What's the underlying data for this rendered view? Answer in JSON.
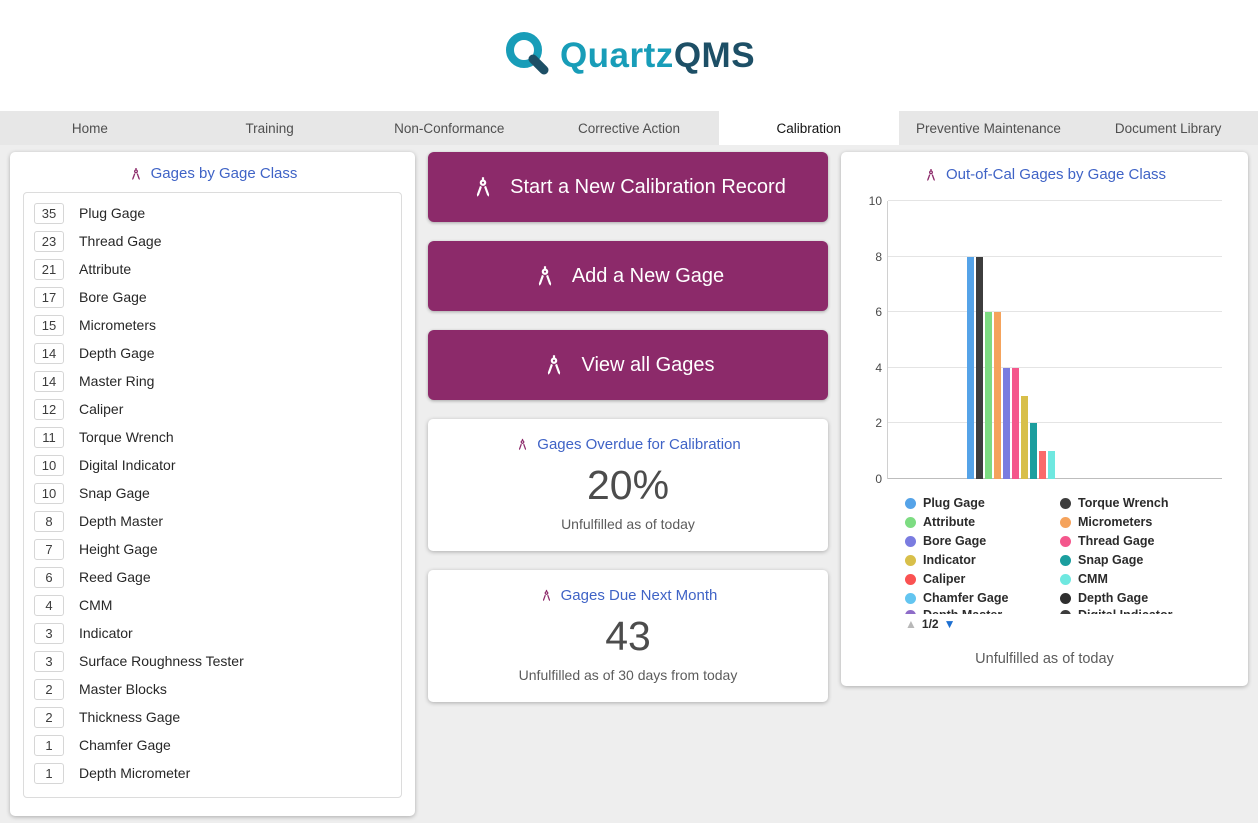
{
  "colors": {
    "accent_purple": "#8c2a6a",
    "title_blue": "#3f63c6",
    "brand_teal": "#189db8",
    "brand_navy": "#1d4f66"
  },
  "brand": {
    "name_primary": "Quartz",
    "name_secondary": "QMS"
  },
  "nav": {
    "active_tab": "Calibration",
    "tabs": [
      "Home",
      "Training",
      "Non-Conformance",
      "Corrective Action",
      "Calibration",
      "Preventive Maintenance",
      "Document Library"
    ]
  },
  "left_panel": {
    "title": "Gages by Gage Class",
    "items": [
      {
        "count": "35",
        "label": "Plug Gage"
      },
      {
        "count": "23",
        "label": "Thread Gage"
      },
      {
        "count": "21",
        "label": "Attribute"
      },
      {
        "count": "17",
        "label": "Bore Gage"
      },
      {
        "count": "15",
        "label": "Micrometers"
      },
      {
        "count": "14",
        "label": "Depth Gage"
      },
      {
        "count": "14",
        "label": "Master Ring"
      },
      {
        "count": "12",
        "label": "Caliper"
      },
      {
        "count": "11",
        "label": "Torque Wrench"
      },
      {
        "count": "10",
        "label": "Digital Indicator"
      },
      {
        "count": "10",
        "label": "Snap Gage"
      },
      {
        "count": "8",
        "label": "Depth Master"
      },
      {
        "count": "7",
        "label": "Height Gage"
      },
      {
        "count": "6",
        "label": "Reed Gage"
      },
      {
        "count": "4",
        "label": "CMM"
      },
      {
        "count": "3",
        "label": "Indicator"
      },
      {
        "count": "3",
        "label": "Surface Roughness Tester"
      },
      {
        "count": "2",
        "label": "Master Blocks"
      },
      {
        "count": "2",
        "label": "Thickness Gage"
      },
      {
        "count": "1",
        "label": "Chamfer Gage"
      },
      {
        "count": "1",
        "label": "Depth Micrometer"
      }
    ]
  },
  "actions": {
    "start_calibration": "Start a New Calibration Record",
    "add_gage": "Add a New Gage",
    "view_gages": "View all Gages"
  },
  "overdue_card": {
    "title": "Gages Overdue for Calibration",
    "value": "20%",
    "subtitle": "Unfulfilled as of today"
  },
  "due_card": {
    "title": "Gages Due Next Month",
    "value": "43",
    "subtitle": "Unfulfilled as of 30 days from today"
  },
  "chart_card": {
    "title": "Out-of-Cal Gages by Gage Class",
    "footer": "Unfulfilled as of today",
    "pagination": {
      "up_glyph": "▲",
      "page_label": "1/2",
      "down_glyph": "▼"
    }
  },
  "chart_data": {
    "type": "bar",
    "title": "Out-of-Cal Gages by Gage Class",
    "categories": [
      "Plug Gage",
      "Torque Wrench",
      "Attribute",
      "Micrometers",
      "Bore Gage",
      "Thread Gage",
      "Indicator",
      "Snap Gage",
      "Caliper",
      "CMM"
    ],
    "values": [
      8,
      8,
      6,
      6,
      4,
      4,
      3,
      2,
      1,
      1
    ],
    "colors": [
      "#55a3e8",
      "#3d3d3d",
      "#7ddc82",
      "#f5a35c",
      "#7a7ce0",
      "#f4578c",
      "#d8bf4a",
      "#1b9e9e",
      "#fa6a6a",
      "#6fe8e0"
    ],
    "ylim": [
      0,
      10
    ],
    "yticks": [
      0,
      2,
      4,
      6,
      8,
      10
    ],
    "grid": true,
    "legend_position": "bottom",
    "legend": [
      {
        "label": "Plug Gage",
        "color": "#55a3e8"
      },
      {
        "label": "Torque Wrench",
        "color": "#3d3d3d"
      },
      {
        "label": "Attribute",
        "color": "#7ddc82"
      },
      {
        "label": "Micrometers",
        "color": "#f5a35c"
      },
      {
        "label": "Bore Gage",
        "color": "#7a7ce0"
      },
      {
        "label": "Thread Gage",
        "color": "#f4578c"
      },
      {
        "label": "Indicator",
        "color": "#d8bf4a"
      },
      {
        "label": "Snap Gage",
        "color": "#1b9e9e"
      },
      {
        "label": "Caliper",
        "color": "#fa5252"
      },
      {
        "label": "CMM",
        "color": "#6fe8e0"
      },
      {
        "label": "Chamfer Gage",
        "color": "#63c5f0"
      },
      {
        "label": "Depth Gage",
        "color": "#2f2f2f"
      }
    ],
    "legend_clipped": [
      {
        "label": "Depth Master",
        "color": "#8e6cc8"
      },
      {
        "label": "Digital Indicator",
        "color": "#3d3d3d"
      }
    ]
  }
}
